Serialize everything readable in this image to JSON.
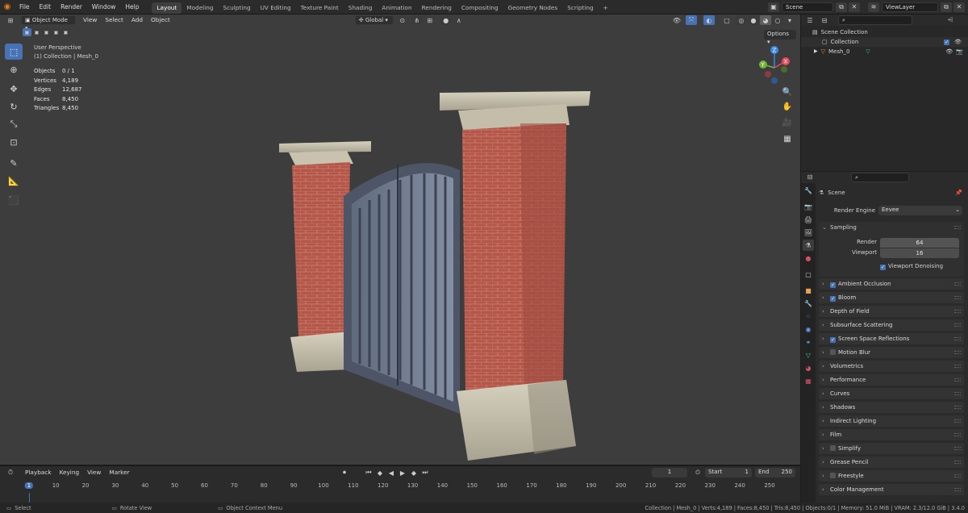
{
  "menu": {
    "items": [
      "File",
      "Edit",
      "Render",
      "Window",
      "Help"
    ]
  },
  "workspaces": [
    {
      "label": "Layout",
      "active": true
    },
    {
      "label": "Modeling"
    },
    {
      "label": "Sculpting"
    },
    {
      "label": "UV Editing"
    },
    {
      "label": "Texture Paint"
    },
    {
      "label": "Shading"
    },
    {
      "label": "Animation"
    },
    {
      "label": "Rendering"
    },
    {
      "label": "Compositing"
    },
    {
      "label": "Geometry Nodes"
    },
    {
      "label": "Scripting"
    }
  ],
  "header_right": {
    "scene": "Scene",
    "view_layer": "ViewLayer"
  },
  "viewport": {
    "mode": "Object Mode",
    "menus": [
      "View",
      "Select",
      "Add",
      "Object"
    ],
    "orientation": "Global",
    "options_label": "Options",
    "perspective": "User Perspective",
    "collection_path": "(1) Collection | Mesh_0",
    "stats": [
      {
        "k": "Objects",
        "v": "0 / 1"
      },
      {
        "k": "Vertices",
        "v": "4,189"
      },
      {
        "k": "Edges",
        "v": "12,687"
      },
      {
        "k": "Faces",
        "v": "8,450"
      },
      {
        "k": "Triangles",
        "v": "8,450"
      }
    ],
    "gizmo": {
      "x": "X",
      "y": "Y",
      "z": "Z"
    }
  },
  "outliner": {
    "scene_collection": "Scene Collection",
    "collection": "Collection",
    "mesh": "Mesh_0"
  },
  "properties": {
    "title": "Scene",
    "render_engine_label": "Render Engine",
    "render_engine": "Eevee",
    "sampling": {
      "label": "Sampling",
      "render_label": "Render",
      "render_value": "64",
      "viewport_label": "Viewport",
      "viewport_value": "16",
      "denoise": "Viewport Denoising"
    },
    "panels": [
      {
        "label": "Ambient Occlusion",
        "checkbox": "on"
      },
      {
        "label": "Bloom",
        "checkbox": "on"
      },
      {
        "label": "Depth of Field"
      },
      {
        "label": "Subsurface Scattering"
      },
      {
        "label": "Screen Space Reflections",
        "checkbox": "on"
      },
      {
        "label": "Motion Blur",
        "checkbox": "off"
      },
      {
        "label": "Volumetrics"
      },
      {
        "label": "Performance"
      },
      {
        "label": "Curves"
      },
      {
        "label": "Shadows"
      },
      {
        "label": "Indirect Lighting"
      },
      {
        "label": "Film"
      },
      {
        "label": "Simplify",
        "checkbox": "off"
      },
      {
        "label": "Grease Pencil"
      },
      {
        "label": "Freestyle",
        "checkbox": "off"
      },
      {
        "label": "Color Management"
      }
    ]
  },
  "timeline": {
    "menus": [
      "Playback",
      "Keying",
      "View",
      "Marker"
    ],
    "current_frame": "1",
    "start_label": "Start",
    "start": "1",
    "end_label": "End",
    "end": "250",
    "ruler": [
      "1",
      "10",
      "20",
      "30",
      "40",
      "50",
      "60",
      "70",
      "80",
      "90",
      "100",
      "110",
      "120",
      "130",
      "140",
      "150",
      "160",
      "170",
      "180",
      "190",
      "200",
      "210",
      "220",
      "230",
      "240",
      "250"
    ]
  },
  "status": {
    "select": "Select",
    "rotate": "Rotate View",
    "context": "Object Context Menu",
    "info": "Collection | Mesh_0 | Verts:4,189 | Faces:8,450 | Tris:8,450 | Objects:0/1 | Memory: 51.0 MiB | VRAM: 2.3/12.0 GiB | 3.4.0"
  },
  "colors": {
    "accent": "#4772b3",
    "viewport_bg": "#3d3d3d",
    "panel_bg": "#2b2b2b"
  }
}
